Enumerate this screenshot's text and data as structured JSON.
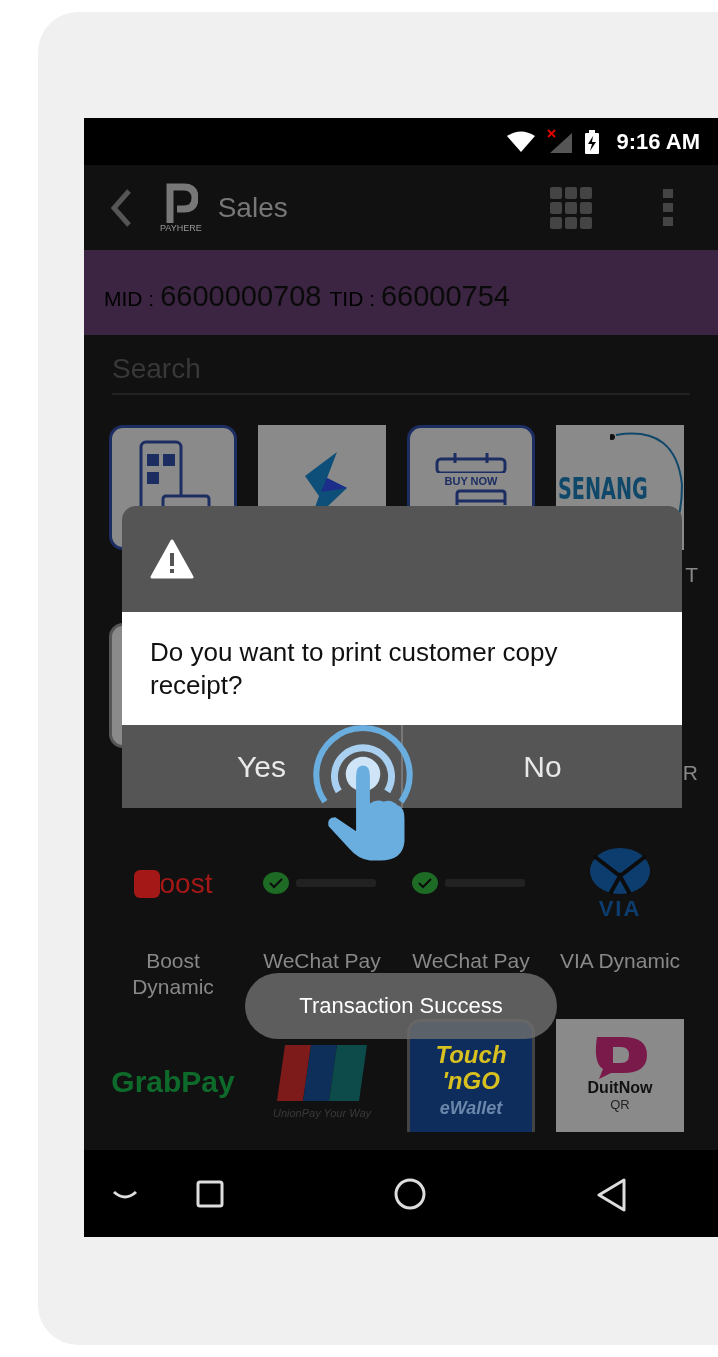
{
  "status_bar": {
    "time": "9:16 AM"
  },
  "app_bar": {
    "logo_text": "PAYHERE",
    "title": "Sales"
  },
  "terminal": {
    "mid_label": "MID :",
    "mid": "6600000708",
    "tid_label": "TID :",
    "tid": "66000754"
  },
  "search": {
    "placeholder": "Search"
  },
  "payment_grid": [
    {
      "kind": "qr-phone"
    },
    {
      "kind": "bolt"
    },
    {
      "kind": "buy-now",
      "logo_text": "BUY NOW"
    },
    {
      "kind": "senang",
      "logo_text": "SENANG",
      "label": "T",
      "label_cut": true
    },
    {
      "kind": "blank"
    },
    {
      "kind": "none"
    },
    {
      "kind": "none"
    },
    {
      "kind": "none",
      "label": "R",
      "label_cut": true
    },
    {
      "kind": "boost",
      "logo_text": "oost",
      "label": "Boost Dynamic"
    },
    {
      "kind": "wechat",
      "label": "WeChat Pay"
    },
    {
      "kind": "wechat",
      "label": "WeChat Pay"
    },
    {
      "kind": "via",
      "logo_text": "VIA",
      "label": "VIA Dynamic"
    },
    {
      "kind": "grabpay",
      "logo_text": "GrabPay"
    },
    {
      "kind": "unionpay",
      "logo_text": "UnionPay Your Way"
    },
    {
      "kind": "touchngo",
      "logo_text": "Touch 'nGO",
      "logo_subtext": "eWallet"
    },
    {
      "kind": "duitnow",
      "logo_text": "DuitNow",
      "logo_subtext": "QR"
    }
  ],
  "dialog": {
    "message": "Do you want to print customer copy receipt?",
    "buttons": [
      "Yes",
      "No"
    ]
  },
  "toast": "Transaction Success"
}
